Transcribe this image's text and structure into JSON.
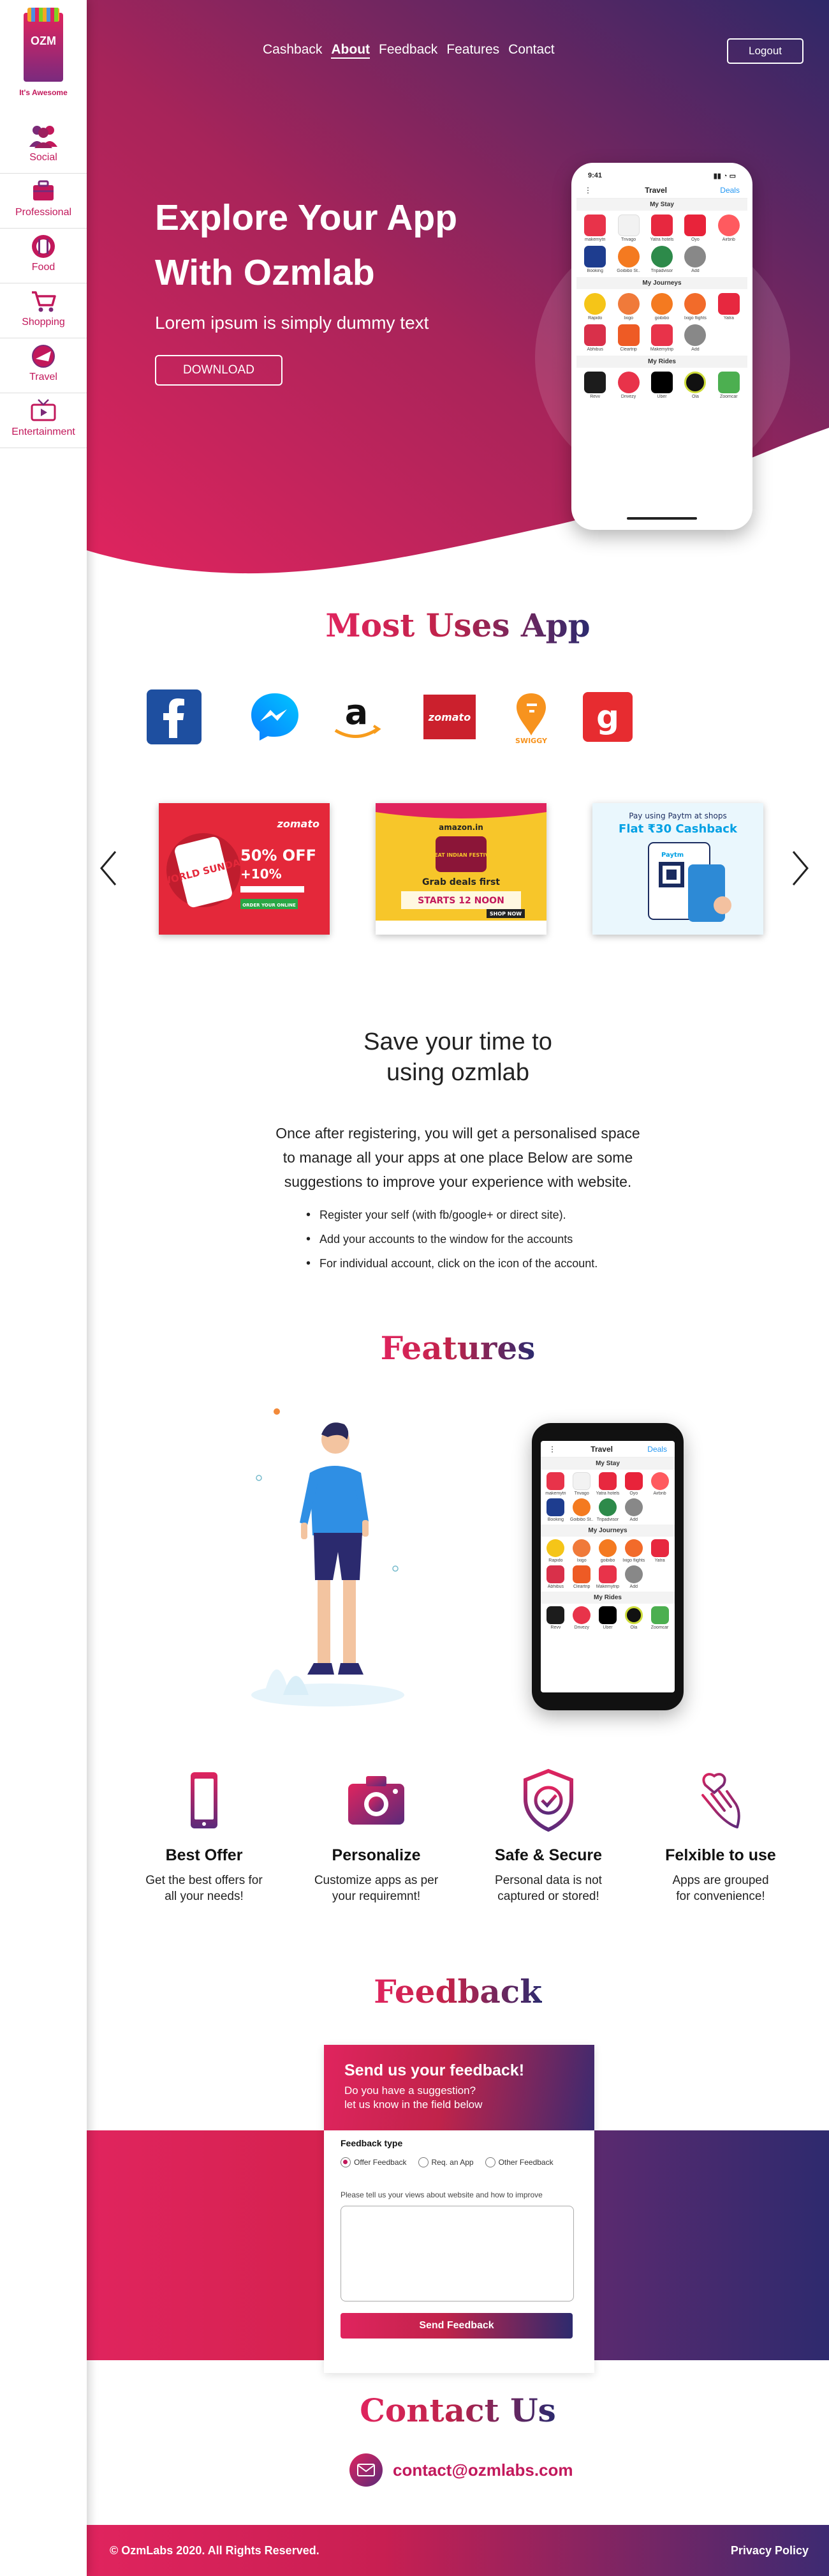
{
  "sidebar": {
    "brand": "OZM",
    "tagline": "It's Awesome",
    "items": [
      {
        "label": "Social"
      },
      {
        "label": "Professional"
      },
      {
        "label": "Food"
      },
      {
        "label": "Shopping"
      },
      {
        "label": "Travel"
      },
      {
        "label": "Entertainment"
      }
    ]
  },
  "nav": {
    "links": [
      "Cashback",
      "About",
      "Feedback",
      "Features",
      "Contact"
    ],
    "active": "About",
    "logout": "Logout"
  },
  "hero": {
    "title_line1": "Explore Your App",
    "title_line2": "With Ozmlab",
    "subtitle": "Lorem ipsum is simply dummy text",
    "download": "DOWNLOAD"
  },
  "phone": {
    "time": "9:41",
    "header_title": "Travel",
    "header_done": "Deals",
    "sections": [
      {
        "title": "My Stay",
        "apps": [
          "makemytri",
          "Trivago",
          "Yatra hotels",
          "Oyo",
          "Airbnb",
          "Booking",
          "Goibibo St..",
          "Tripadvisor",
          "Add"
        ]
      },
      {
        "title": "My Journeys",
        "apps": [
          "Rapido",
          "Ixigo",
          "goibibo",
          "Ixigo flights",
          "Yatra",
          "Abhibus",
          "Cleartrip",
          "Makemytrip",
          "Add"
        ]
      },
      {
        "title": "My Rides",
        "apps": [
          "Revv",
          "Drivezy",
          "Uber",
          "Ola",
          "Zoomcar"
        ]
      }
    ]
  },
  "most_used": {
    "title": "Most Uses App",
    "brands": [
      "facebook-icon",
      "messenger-icon",
      "amazon-icon",
      "zomato-icon",
      "swiggy-icon",
      "gaana-icon"
    ],
    "zomato_text": "zomato",
    "swiggy_text": "SWIGGY",
    "carousel": [
      {
        "brand": "zomato",
        "headline": "50% OFF",
        "sub": "+10%",
        "tag": "ORDER YOUR ONLINE",
        "badge": "WORLD SUNDAY"
      },
      {
        "brand": "amazon.in",
        "headline": "GREAT INDIAN FESTIVAL",
        "sub": "Grab deals first",
        "tag": "STARTS 12 NOON",
        "btn": "SHOP NOW"
      },
      {
        "brand": "Paytm",
        "headline": "Pay using Paytm at shops",
        "sub": "Flat ₹30 Cashback"
      }
    ]
  },
  "save": {
    "title_line1": "Save your time to",
    "title_line2": "using ozmlab",
    "text_line1": "Once after registering, you will get a personalised space",
    "text_line2": "to manage all your apps at one place Below are some",
    "text_line3": "suggestions to improve your experience with website.",
    "bullets": [
      "Register your self (with fb/google+ or direct site).",
      "Add your accounts to the window for the accounts",
      "For individual account, click on the icon of the account."
    ]
  },
  "features": {
    "title": "Features",
    "items": [
      {
        "title": "Best Offer",
        "line1": "Get the best offers for",
        "line2": "all your needs!"
      },
      {
        "title": "Personalize",
        "line1": "Customize apps as per",
        "line2": "your requiremnt!"
      },
      {
        "title": "Safe & Secure",
        "line1": "Personal data is not",
        "line2": "captured or stored!"
      },
      {
        "title": "Felxible to use",
        "line1": "Apps are grouped",
        "line2": "for convenience!"
      }
    ]
  },
  "feedback": {
    "title": "Feedback",
    "card_title": "Send us your feedback!",
    "card_sub1": "Do you have a suggestion?",
    "card_sub2": "let us know in the field below",
    "type_label": "Feedback type",
    "options": [
      "Offer Feedback",
      "Req. an App",
      "Other Feedback"
    ],
    "selected": "Offer Feedback",
    "hint": "Please tell us your views about website and how to improve",
    "send": "Send Feedback"
  },
  "contact": {
    "title": "Contact Us",
    "email": "contact@ozmlabs.com"
  },
  "footer": {
    "copyright": "© OzmLabs 2020. All Rights Reserved.",
    "privacy": "Privacy Policy"
  },
  "colors": {
    "accent": "#e0245e",
    "brand_dark": "#2b2a6e"
  }
}
